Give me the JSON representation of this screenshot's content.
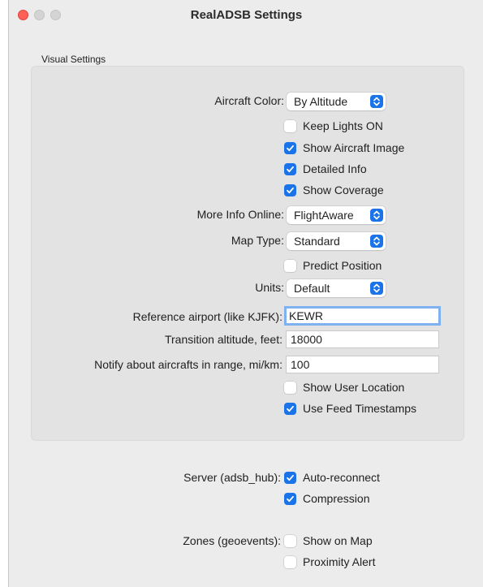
{
  "window": {
    "title": "RealADSB Settings"
  },
  "visual_settings": {
    "group_label": "Visual Settings",
    "aircraft_color": {
      "label": "Aircraft Color:",
      "value": "By Altitude"
    },
    "keep_lights_on": {
      "label": "Keep Lights ON",
      "checked": false
    },
    "show_aircraft_image": {
      "label": "Show Aircraft Image",
      "checked": true
    },
    "detailed_info": {
      "label": "Detailed Info",
      "checked": true
    },
    "show_coverage": {
      "label": "Show Coverage",
      "checked": true
    },
    "more_info_online": {
      "label": "More Info Online:",
      "value": "FlightAware"
    },
    "map_type": {
      "label": "Map Type:",
      "value": "Standard"
    },
    "predict_position": {
      "label": "Predict Position",
      "checked": false
    },
    "units": {
      "label": "Units:",
      "value": "Default"
    },
    "reference_airport": {
      "label": "Reference airport (like KJFK):",
      "value": "KEWR"
    },
    "transition_altitude": {
      "label": "Transition altitude, feet:",
      "value": "18000"
    },
    "notify_range": {
      "label": "Notify about aircrafts in range, mi/km:",
      "value": "100"
    },
    "show_user_location": {
      "label": "Show User Location",
      "checked": false
    },
    "use_feed_timestamps": {
      "label": "Use Feed Timestamps",
      "checked": true
    }
  },
  "server": {
    "label": "Server (adsb_hub):",
    "auto_reconnect": {
      "label": "Auto-reconnect",
      "checked": true
    },
    "compression": {
      "label": "Compression",
      "checked": true
    }
  },
  "zones": {
    "label": "Zones (geoevents):",
    "show_on_map": {
      "label": "Show on Map",
      "checked": false
    },
    "proximity_alert": {
      "label": "Proximity Alert",
      "checked": false
    }
  },
  "colors": {
    "accent": "#1a73e8",
    "close_button": "#fe5f57",
    "window_bg": "#ececec",
    "group_bg": "#e3e3e3"
  }
}
